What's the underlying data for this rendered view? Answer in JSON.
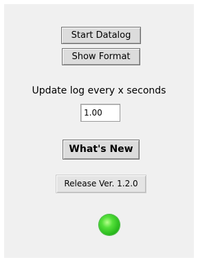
{
  "controls": {
    "start_datalog_label": "Start Datalog",
    "show_format_label": "Show Format",
    "update_interval_label": "Update log every x seconds",
    "update_interval_value": "1.00",
    "whats_new_label": "What's New",
    "release_label": "Release Ver. 1.2.0"
  },
  "status_led": {
    "state": "on",
    "color": "#3cd22a"
  },
  "colors": {
    "panel_background": "#f0f0f0",
    "button_face": "#dcdcdc",
    "release_box": "#e4e4e4"
  }
}
